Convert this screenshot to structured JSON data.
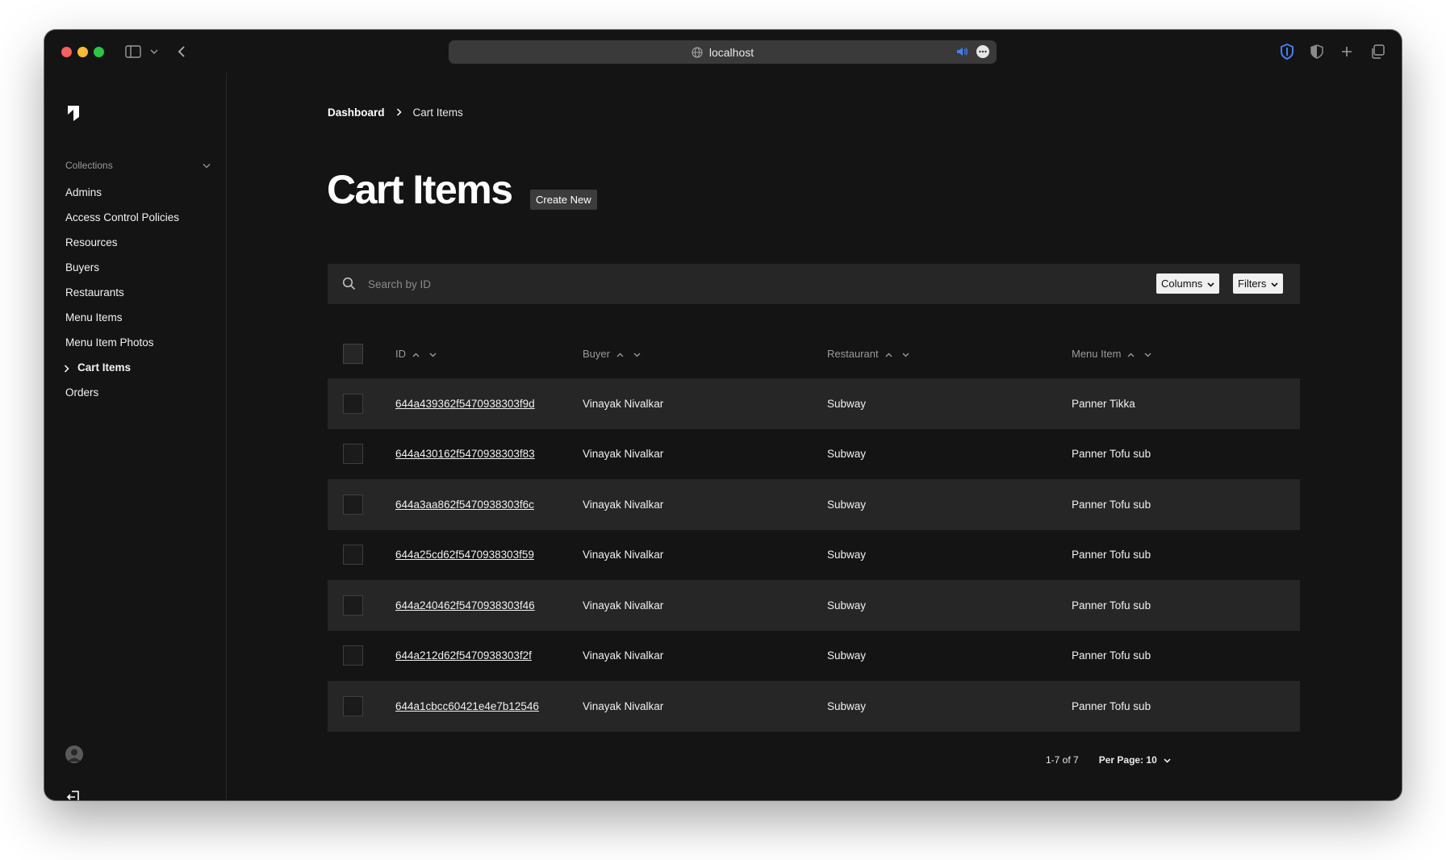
{
  "browser": {
    "url": "localhost"
  },
  "sidebar": {
    "section_label": "Collections",
    "items": [
      {
        "label": "Admins"
      },
      {
        "label": "Access Control Policies"
      },
      {
        "label": "Resources"
      },
      {
        "label": "Buyers"
      },
      {
        "label": "Restaurants"
      },
      {
        "label": "Menu Items"
      },
      {
        "label": "Menu Item Photos"
      },
      {
        "label": "Cart Items",
        "active": true
      },
      {
        "label": "Orders"
      }
    ]
  },
  "breadcrumb": {
    "root": "Dashboard",
    "current": "Cart Items"
  },
  "page": {
    "title": "Cart Items",
    "create_label": "Create New"
  },
  "search": {
    "placeholder": "Search by ID",
    "columns_label": "Columns",
    "filters_label": "Filters"
  },
  "table": {
    "columns": [
      "ID",
      "Buyer",
      "Restaurant",
      "Menu Item"
    ],
    "rows": [
      {
        "id": "644a439362f5470938303f9d",
        "buyer": "Vinayak Nivalkar",
        "restaurant": "Subway",
        "menu_item": "Panner Tikka"
      },
      {
        "id": "644a430162f5470938303f83",
        "buyer": "Vinayak Nivalkar",
        "restaurant": "Subway",
        "menu_item": "Panner Tofu sub"
      },
      {
        "id": "644a3aa862f5470938303f6c",
        "buyer": "Vinayak Nivalkar",
        "restaurant": "Subway",
        "menu_item": "Panner Tofu sub"
      },
      {
        "id": "644a25cd62f5470938303f59",
        "buyer": "Vinayak Nivalkar",
        "restaurant": "Subway",
        "menu_item": "Panner Tofu sub"
      },
      {
        "id": "644a240462f5470938303f46",
        "buyer": "Vinayak Nivalkar",
        "restaurant": "Subway",
        "menu_item": "Panner Tofu sub"
      },
      {
        "id": "644a212d62f5470938303f2f",
        "buyer": "Vinayak Nivalkar",
        "restaurant": "Subway",
        "menu_item": "Panner Tofu sub"
      },
      {
        "id": "644a1cbcc60421e4e7b12546",
        "buyer": "Vinayak Nivalkar",
        "restaurant": "Subway",
        "menu_item": "Panner Tofu sub"
      }
    ]
  },
  "pagination": {
    "range": "1-7 of 7",
    "per_page": "Per Page: 10"
  },
  "colors": {
    "window_bg": "#141414",
    "row_shade": "#262626",
    "accent_shield": "#3b82f6"
  }
}
